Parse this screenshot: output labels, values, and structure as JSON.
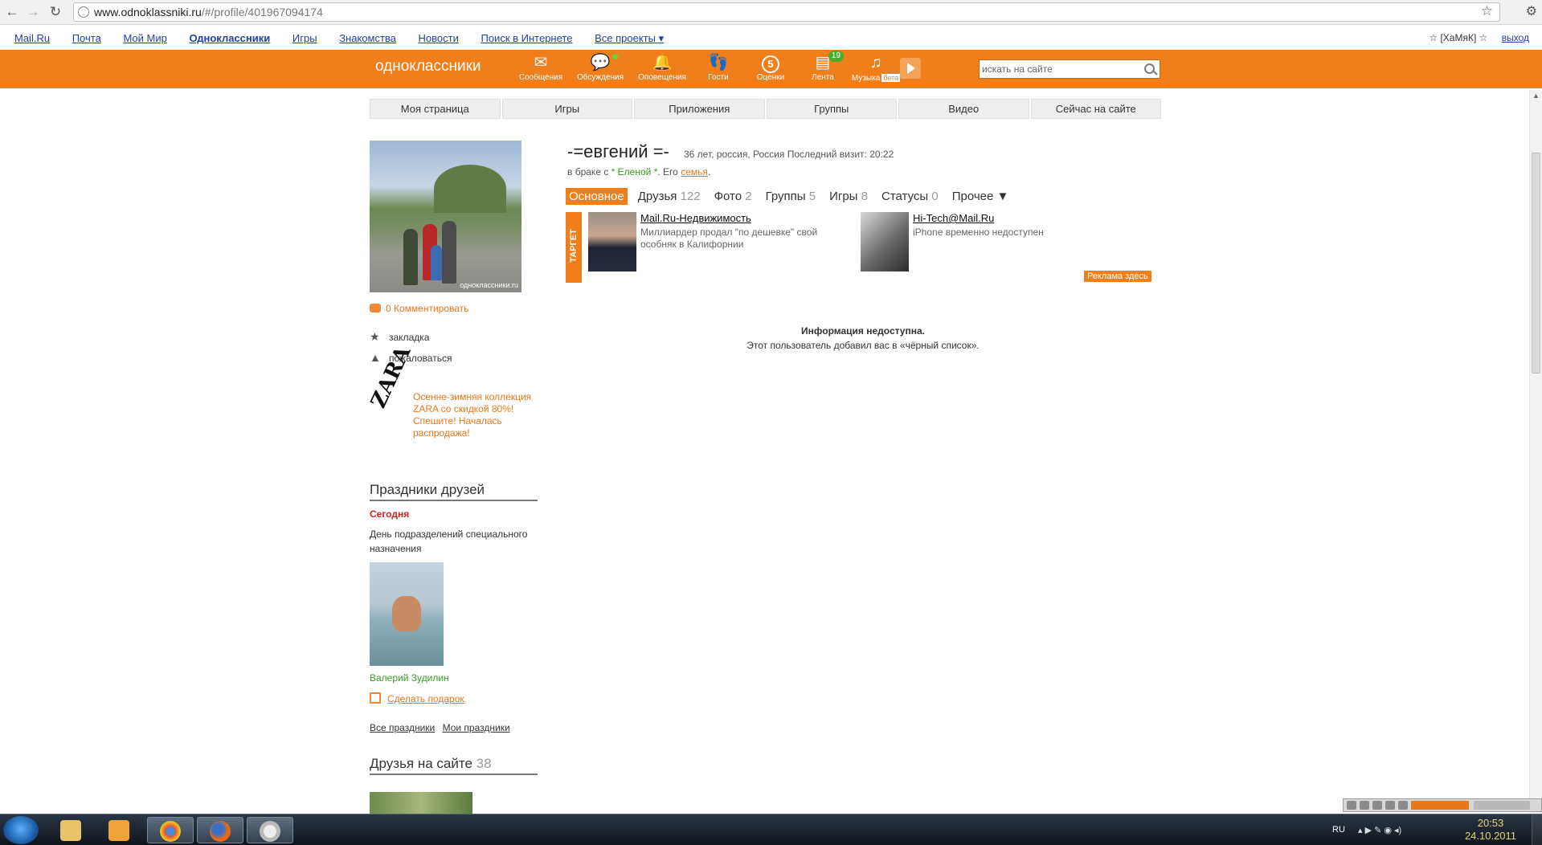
{
  "browser": {
    "url_host": "www.odnoklassniki.ru",
    "url_rest": "/#/profile/401967094174"
  },
  "portal": {
    "links": [
      "Mail.Ru",
      "Почта",
      "Мой Мир",
      "Одноклассники",
      "Игры",
      "Знакомства",
      "Новости",
      "Поиск в Интернете",
      "Все проекты ▾"
    ],
    "user": "☆ [ХаМяК] ☆",
    "logout": "выход"
  },
  "header": {
    "logo": "одноклассники",
    "icons": {
      "messages": "Сообщения",
      "discussions": "Обсуждения",
      "alerts": "Оповещения",
      "guests": "Гости",
      "ratings": "Оценки",
      "ratings_count": "5",
      "feed": "Лента",
      "feed_badge": "19",
      "music": "Музыка",
      "music_beta": "бета"
    },
    "search_placeholder": "искать на сайте"
  },
  "subnav": [
    "Моя страница",
    "Игры",
    "Приложения",
    "Группы",
    "Видео",
    "Сейчас на сайте"
  ],
  "left": {
    "avatar_watermark": "одноклассники.ru",
    "comments": "0 Комментировать",
    "bookmark": "закладка",
    "complain": "пожаловаться",
    "zara_logo": "ZARA",
    "zara_text": "Осенне-зимняя коллекция ZARA со скидкой 80%! Спешите! Началась распродажа!",
    "holidays_title": "Праздники друзей",
    "today": "Сегодня",
    "holiday_text": "День подразделений специального назначения",
    "friend_name": "Валерий Зудилин",
    "gift": "Сделать подарок",
    "all_holidays": "Все праздники",
    "my_holidays": "Мои праздники",
    "friends_title": "Друзья на сайте",
    "friends_count": "38"
  },
  "profile": {
    "name": "-=евгений =-",
    "meta": "36 лет, россия, Россия  Последний визит: 20:22",
    "marriage_prefix": "в браке с",
    "spouse": "* Еленой *",
    "family_prefix": ". Его",
    "family_link": "семья",
    "family_suffix": ".",
    "tabs": [
      {
        "label": "Основное",
        "count": ""
      },
      {
        "label": "Друзья",
        "count": "122"
      },
      {
        "label": "Фото",
        "count": "2"
      },
      {
        "label": "Группы",
        "count": "5"
      },
      {
        "label": "Игры",
        "count": "8"
      },
      {
        "label": "Статусы",
        "count": "0"
      },
      {
        "label": "Прочее ▼",
        "count": ""
      }
    ]
  },
  "ads": {
    "target_label": "ТАРГЕТ",
    "ad1_title": "Mail.Ru-Недвижимость",
    "ad1_desc": "Миллиардер продал \"по дешевке\" свой особняк в Калифорнии",
    "ad2_title": "Hi-Tech@Mail.Ru",
    "ad2_desc": "iPhone временно недоступен",
    "advertise_here": "Реклама здесь"
  },
  "notice": {
    "title": "Информация недоступна.",
    "text": "Этот пользователь добавил вас в «чёрный список»."
  },
  "taskbar": {
    "lang": "RU",
    "time": "20:53",
    "date": "24.10.2011"
  },
  "colors": {
    "brand_orange": "#f07e1b",
    "link_blue": "#22419e",
    "green": "#3a9a23"
  }
}
